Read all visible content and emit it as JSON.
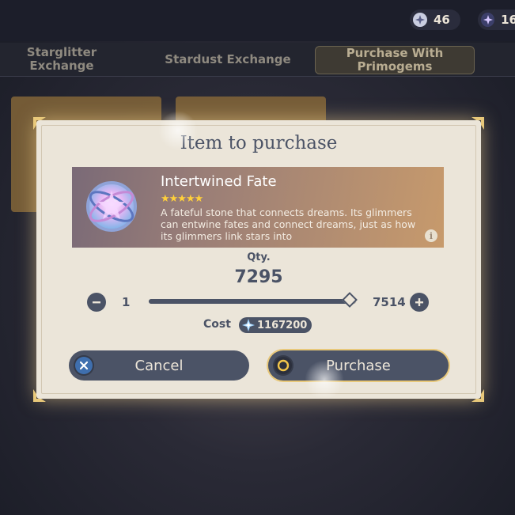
{
  "currency": [
    {
      "icon": "masterless-stardust-icon",
      "value": "46"
    },
    {
      "icon": "masterless-starglitter-icon",
      "value": "16"
    }
  ],
  "tabs": [
    {
      "label": "Starglitter Exchange",
      "active": false
    },
    {
      "label": "Stardust Exchange",
      "active": false
    },
    {
      "label": "Purchase With Primogems",
      "active": true
    }
  ],
  "dialog": {
    "title": "Item to purchase",
    "item": {
      "name": "Intertwined Fate",
      "rarity": 5,
      "stars": "★★★★★",
      "description": "A fateful stone that connects dreams. Its glimmers can entwine fates and connect dreams, just as how its glimmers link stars into",
      "icon": "intertwined-fate-icon"
    },
    "quantity": {
      "label": "Qty.",
      "value": "7295",
      "min": "1",
      "max": "7514",
      "fill_fraction": 0.971
    },
    "cost": {
      "label": "Cost",
      "value": "1167200",
      "icon": "primogem-icon"
    },
    "buttons": {
      "cancel": "Cancel",
      "purchase": "Purchase"
    }
  },
  "colors": {
    "accent": "#4b5366",
    "panel": "#ebe5d9",
    "star": "#ffd03a"
  }
}
